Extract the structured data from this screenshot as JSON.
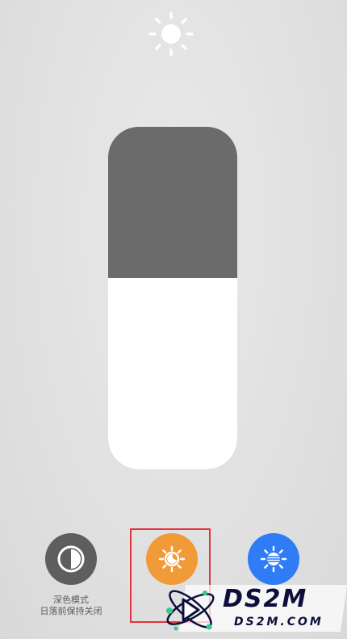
{
  "brightness": {
    "icon": "sun-icon",
    "level_percent": 56
  },
  "controls": {
    "dark_mode": {
      "icon": "dark-mode-icon",
      "title": "深色模式",
      "subtitle": "日落前保持关闭"
    },
    "night_shift": {
      "icon": "night-shift-icon",
      "accent": "#f19a38"
    },
    "true_tone": {
      "icon": "true-tone-icon",
      "accent": "#2f7cf6"
    }
  },
  "colors": {
    "slider_track": "#6b6b6b",
    "slider_fill": "#ffffff",
    "highlight": "#e2353b",
    "dark_button": "#5e5e5e"
  },
  "watermark": {
    "main": "DS2M",
    "sub": "DS2M.COM"
  }
}
